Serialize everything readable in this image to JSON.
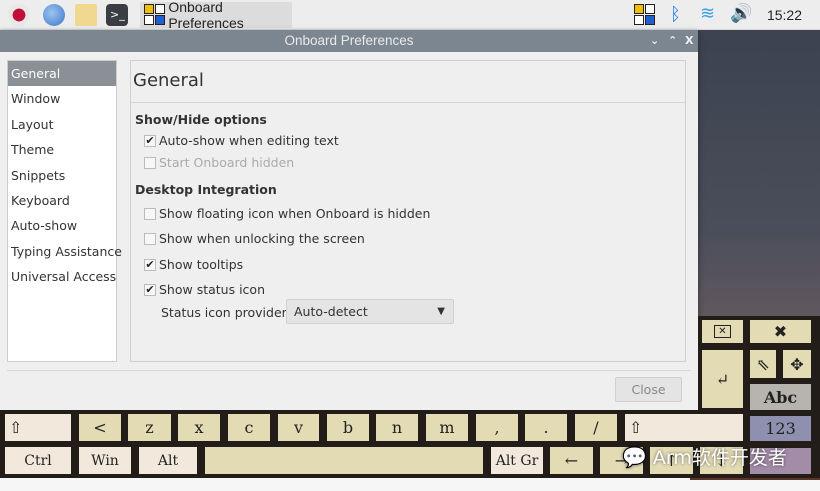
{
  "taskbar": {
    "app_title": "Onboard Preferences",
    "clock": "15:22",
    "icons": [
      "raspberry-menu-icon",
      "web-browser-icon",
      "file-manager-icon",
      "terminal-icon",
      "onboard-tray-icon",
      "bluetooth-icon",
      "wifi-icon",
      "volume-icon"
    ]
  },
  "dialog": {
    "title": "Onboard Preferences",
    "sidebar": {
      "items": [
        {
          "label": "General",
          "selected": true
        },
        {
          "label": "Window"
        },
        {
          "label": "Layout"
        },
        {
          "label": "Theme"
        },
        {
          "label": "Snippets"
        },
        {
          "label": "Keyboard"
        },
        {
          "label": "Auto-show"
        },
        {
          "label": "Typing Assistance"
        },
        {
          "label": "Universal Access"
        }
      ]
    },
    "panel": {
      "title": "General",
      "section1": "Show/Hide options",
      "section2": "Desktop Integration",
      "options": [
        {
          "label": "Auto-show when editing text",
          "checked": true,
          "enabled": true
        },
        {
          "label": "Start Onboard hidden",
          "checked": false,
          "enabled": false
        },
        {
          "label": "Show floating icon when Onboard is hidden",
          "checked": false,
          "enabled": false
        },
        {
          "label": "Show when unlocking the screen",
          "checked": false,
          "enabled": false
        },
        {
          "label": "Show tooltips",
          "checked": true,
          "enabled": true
        },
        {
          "label": "Show status icon",
          "checked": true,
          "enabled": true
        }
      ],
      "provider_label": "Status icon provider:",
      "provider_value": "Auto-detect"
    },
    "close_label": "Close"
  },
  "keyboard": {
    "row1": [
      "⇧",
      "<",
      "z",
      "x",
      "c",
      "v",
      "b",
      "n",
      "m",
      ",",
      ".",
      "/",
      "⇧"
    ],
    "row2": [
      "Ctrl",
      "Win",
      "Alt",
      "",
      "Alt Gr",
      "←",
      "→",
      "↑",
      "↓"
    ],
    "side": {
      "hide": "✖",
      "abc": "Abc",
      "num": "123"
    },
    "colors": {
      "key": "#e3dbb4",
      "modifier": "#f2e9dc",
      "abc": "#b6b4ac",
      "num": "#8f8fb0",
      "last": "#a38ca8"
    }
  },
  "watermark": "Arm软件开发者"
}
